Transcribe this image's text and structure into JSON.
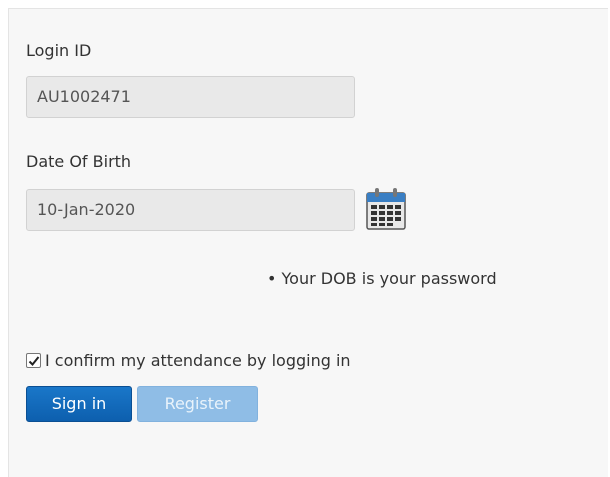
{
  "form": {
    "login_id_label": "Login ID",
    "login_id_value": "AU1002471",
    "dob_label": "Date Of Birth",
    "dob_value": "10-Jan-2020",
    "calendar_icon": "calendar-icon",
    "password_note": "• Your DOB is your password",
    "confirm_checked": true,
    "confirm_label": "I confirm my attendance by logging in",
    "signin_label": "Sign in",
    "register_label": "Register"
  },
  "colors": {
    "panel_bg": "#f7f7f7",
    "field_bg": "#e9e9e9",
    "signin_bg": "#1268bb",
    "register_bg": "#8fbde6"
  }
}
